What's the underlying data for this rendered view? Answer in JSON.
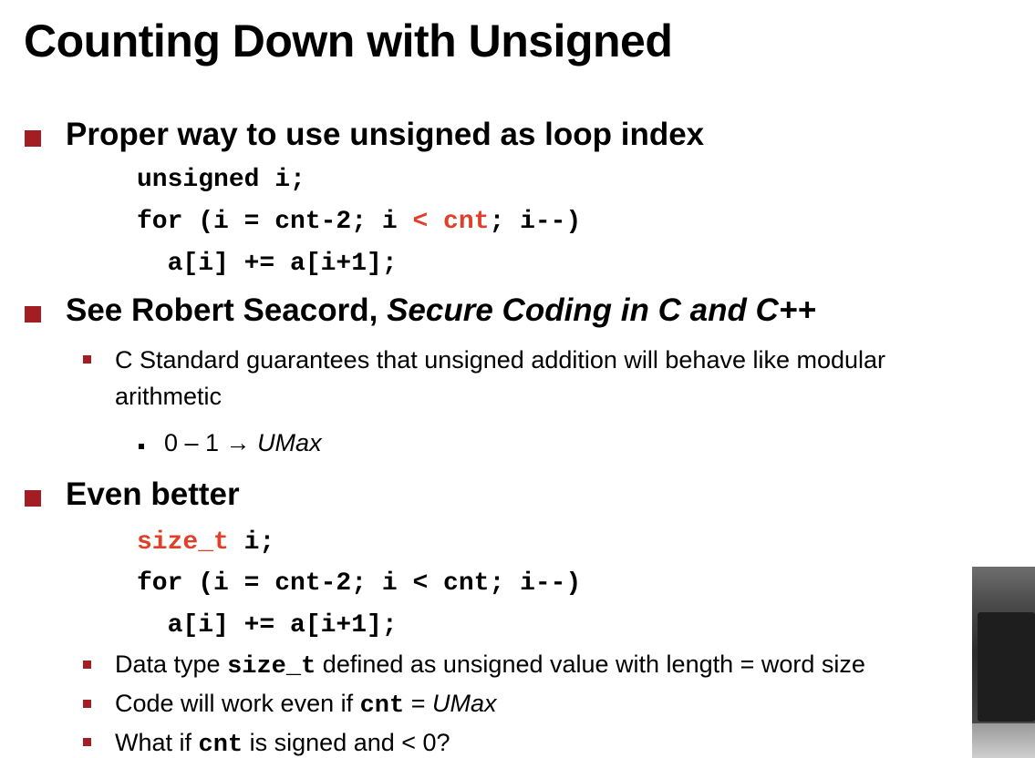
{
  "title": "Counting Down with Unsigned",
  "bullet1": {
    "text": "Proper way to use unsigned as loop index",
    "code": {
      "line1": "unsigned i;",
      "line2_pre": "for (i = cnt-2; i ",
      "line2_red": "< cnt",
      "line2_post": "; i--)",
      "line3": "  a[i] += a[i+1];"
    }
  },
  "bullet2": {
    "text_pre": "See Robert Seacord, ",
    "text_italic": "Secure Coding in C and C++",
    "sub1": {
      "line1": "C Standard guarantees that unsigned addition will behave like modular",
      "line2": "arithmetic"
    },
    "subsub1": {
      "pre": "0 – 1 → ",
      "italic": "UMax"
    }
  },
  "bullet3": {
    "text": "Even better",
    "code": {
      "line1_red": "size_t",
      "line1_post": " i;",
      "line2": "for (i = cnt-2; i < cnt; i--)",
      "line3": "  a[i] += a[i+1];"
    },
    "sub1": {
      "pre": "Data type ",
      "mono": "size_t",
      "post": " defined as unsigned value with length = word size"
    },
    "sub2": {
      "pre": "Code will work even if ",
      "mono": "cnt",
      "mid": " = ",
      "italic": "UMax"
    },
    "sub3": {
      "pre": "What if ",
      "mono": "cnt",
      "post": " is signed and < 0?"
    }
  },
  "colors": {
    "bullet_square": "#a31e22",
    "code_highlight": "#e0402a"
  }
}
